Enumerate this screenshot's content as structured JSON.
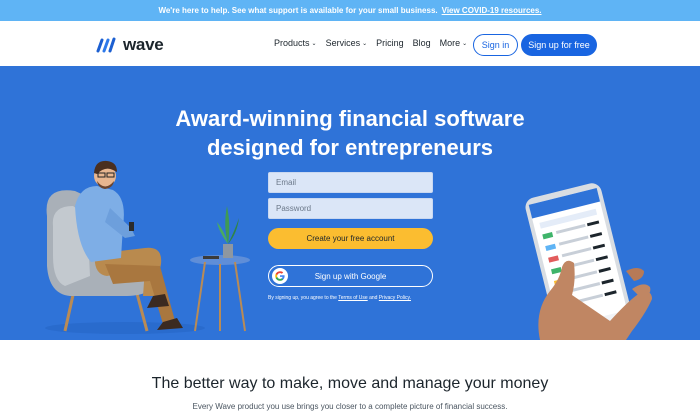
{
  "banner": {
    "text": "We're here to help. See what support is available for your small business.",
    "link": "View COVID-19 resources."
  },
  "header": {
    "logo_text": "wave",
    "nav": [
      {
        "label": "Products",
        "has_dropdown": true
      },
      {
        "label": "Services",
        "has_dropdown": true
      },
      {
        "label": "Pricing",
        "has_dropdown": false
      },
      {
        "label": "Blog",
        "has_dropdown": false
      },
      {
        "label": "More",
        "has_dropdown": true
      }
    ],
    "signin_label": "Sign in",
    "signup_label": "Sign up for free"
  },
  "hero": {
    "title_line1": "Award-winning financial software",
    "title_line2": "designed for entrepreneurs",
    "email_placeholder": "Email",
    "password_placeholder": "Password",
    "create_label": "Create your free account",
    "google_label": "Sign up with Google",
    "legal_prefix": "By signing up, you agree to the",
    "legal_terms": "Terms of Use",
    "legal_and": "and",
    "legal_privacy": "Privacy Policy."
  },
  "section": {
    "tagline": "The better way to make, move and manage your money",
    "subtag": "Every Wave product you use brings you closer to a complete picture of financial success."
  },
  "colors": {
    "banner": "#5fb4f5",
    "hero_bg": "#2f73d8",
    "brand_blue": "#1965e1",
    "cta_yellow": "#fbbd30"
  }
}
